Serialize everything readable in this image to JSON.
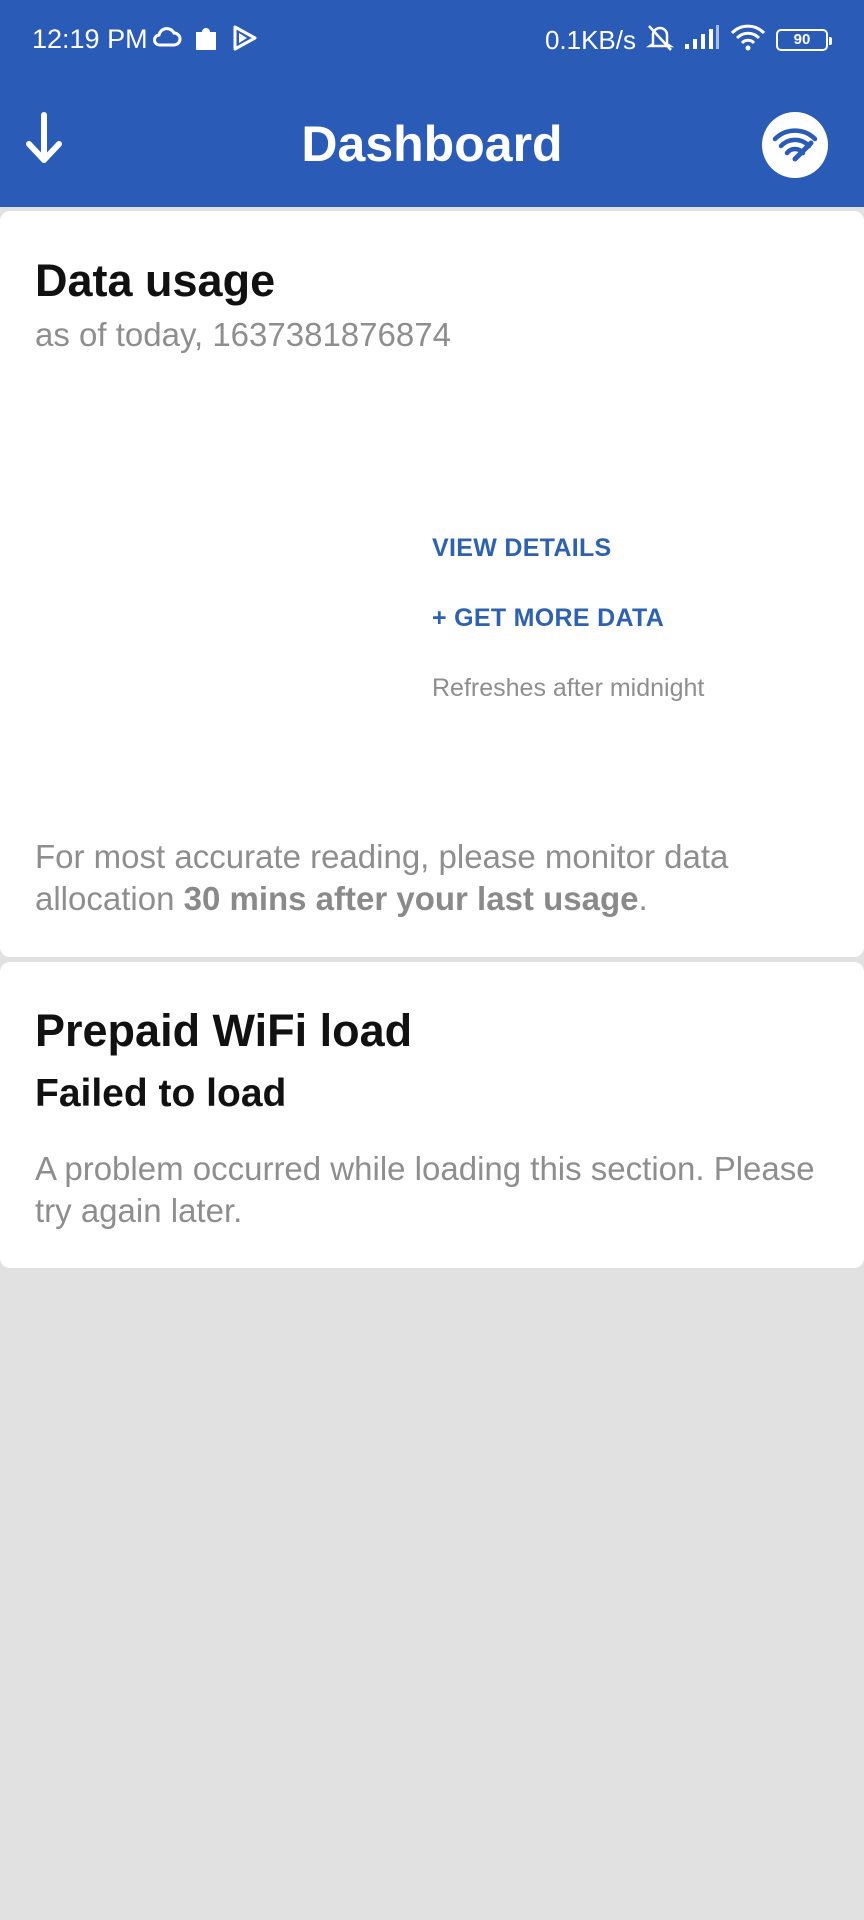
{
  "status_bar": {
    "time": "12:19 PM",
    "net_speed": "0.1KB/s",
    "battery": "90",
    "left_icons": [
      "cloud-icon",
      "puzzle-icon",
      "play-icon"
    ],
    "right_icons": [
      "bell-off-icon",
      "signal-icon",
      "wifi-icon",
      "battery-icon"
    ]
  },
  "app_bar": {
    "title": "Dashboard",
    "left_icon": "arrow-down-icon",
    "right_icon": "wifi-wrench-icon"
  },
  "data_usage": {
    "title": "Data usage",
    "as_of": "as of today, 1637381876874",
    "view_details": "VIEW DETAILS",
    "get_more_data": "+ GET MORE DATA",
    "refresh_note": "Refreshes after midnight",
    "note_prefix": "For most accurate reading, please monitor data allocation ",
    "note_bold": "30 mins after your last usage",
    "note_suffix": "."
  },
  "prepaid_wifi": {
    "title": "Prepaid WiFi load",
    "status": "Failed to load",
    "message": "A problem occurred while loading this section. Please try again later."
  },
  "colors": {
    "primary": "#295bb7",
    "link": "#2f62ae",
    "background": "#e1e1e1",
    "secondary_text": "#8e8e8e"
  }
}
